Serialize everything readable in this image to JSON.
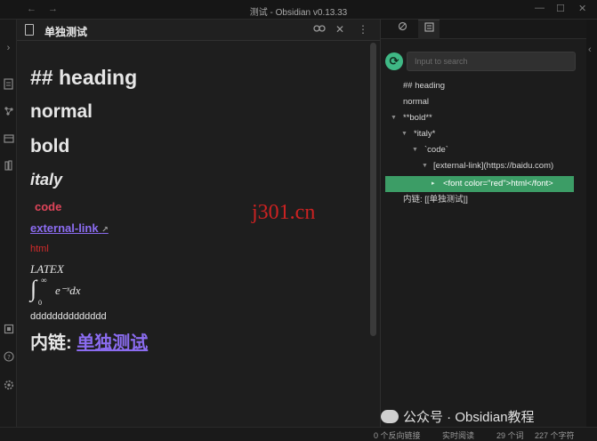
{
  "window": {
    "title": "测试 - Obsidian v0.13.33",
    "back_arrow": "←",
    "forward_arrow": "→",
    "minimize": "—",
    "maximize": "☐",
    "close": "✕"
  },
  "ribbon": {
    "icons": [
      "chevron-right-icon",
      "file-icon",
      "graph-icon",
      "calendar-icon",
      "book-icon",
      "vault-icon",
      "help-icon",
      "settings-icon"
    ]
  },
  "editor": {
    "tab_title": "单独测试",
    "heading": "## heading",
    "normal": "normal",
    "bold": "bold",
    "italic": "italy",
    "code": "code",
    "link": "external-link",
    "link_icon": "↗",
    "html": "html",
    "latex": "LATEX",
    "integral_sup": "∞",
    "integral_sub": "0",
    "integral_body": "e⁻ˣdx",
    "long_text": "dddddddddddddd",
    "inner_link_label": "内链:",
    "inner_link_target": "单独测试",
    "colors": {
      "code": "#e0455a",
      "link": "#8b6cf0",
      "html": "#d12b2b"
    }
  },
  "sidebar": {
    "search_placeholder": "Input to search",
    "toc": [
      {
        "text": "## heading",
        "tri": ""
      },
      {
        "text": "normal",
        "tri": ""
      },
      {
        "text": "**bold**",
        "tri": "▼"
      },
      {
        "text": "*italy*",
        "tri": "▼"
      },
      {
        "text": "`code`",
        "tri": "▼"
      },
      {
        "text": "[external-link](https://baidu.com)",
        "tri": "▼"
      },
      {
        "text": "<font color=\"red\">html</font>",
        "tri": "▸"
      },
      {
        "text": "内链: [[单独测试]]",
        "tri": ""
      }
    ],
    "accent": "#3fb885"
  },
  "status": {
    "backlinks": "0 个反向链接",
    "mode": "实时阅读",
    "words": "29 个词",
    "chars": "227 个字符"
  },
  "watermark": "j301.cn",
  "wechat": "公众号 · Obsidian教程"
}
